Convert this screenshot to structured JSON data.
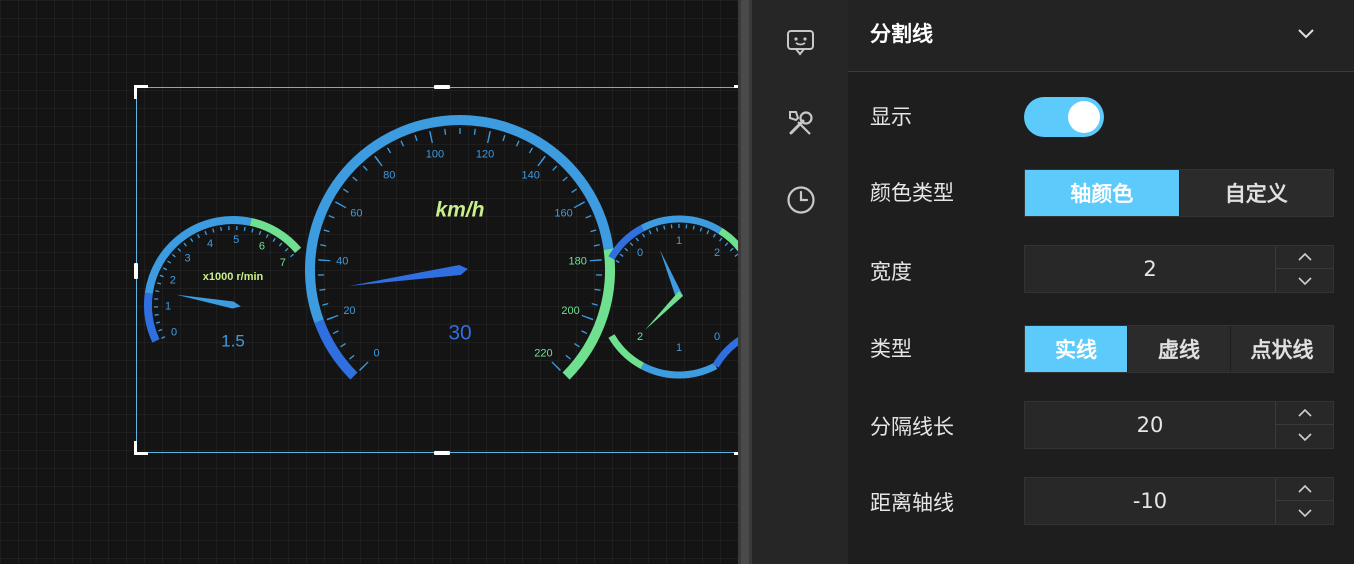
{
  "panel": {
    "title": "分割线",
    "rows": {
      "show": {
        "label": "显示",
        "on": true
      },
      "color_type": {
        "label": "颜色类型",
        "options": [
          "轴颜色",
          "自定义"
        ],
        "selected": 0
      },
      "width": {
        "label": "宽度",
        "value": "2"
      },
      "line_type": {
        "label": "类型",
        "options": [
          "实线",
          "虚线",
          "点状线"
        ],
        "selected": 0
      },
      "split_length": {
        "label": "分隔线长",
        "value": "20"
      },
      "axis_distance": {
        "label": "距离轴线",
        "value": "-10"
      }
    }
  },
  "toolbar": {
    "icons": [
      "chat-icon",
      "wrench-screwdriver-icon",
      "clock-icon"
    ]
  },
  "colors": {
    "accent": "#5ccafa",
    "gauge_blue": "#3d9be0",
    "gauge_dark_blue": "#2f6fe0",
    "gauge_green": "#6fe08f",
    "label_yellow": "#c9ef8a"
  },
  "gauges": {
    "speed": {
      "unit": "km/h",
      "value": "30",
      "ticks": [
        "0",
        "20",
        "40",
        "60",
        "80",
        "100",
        "120",
        "140",
        "160",
        "180",
        "200",
        "220"
      ],
      "pointer_value": 30
    },
    "rpm": {
      "unit": "x1000 r/min",
      "value": "1.5",
      "ticks": [
        "0",
        "1",
        "2",
        "3",
        "4",
        "5",
        "6",
        "7"
      ],
      "pointer_value": 1.5
    },
    "fuel": {
      "ticks_top": [
        "0",
        "1",
        "2"
      ],
      "ticks_bottom": [
        "2",
        "1",
        "0"
      ]
    }
  }
}
